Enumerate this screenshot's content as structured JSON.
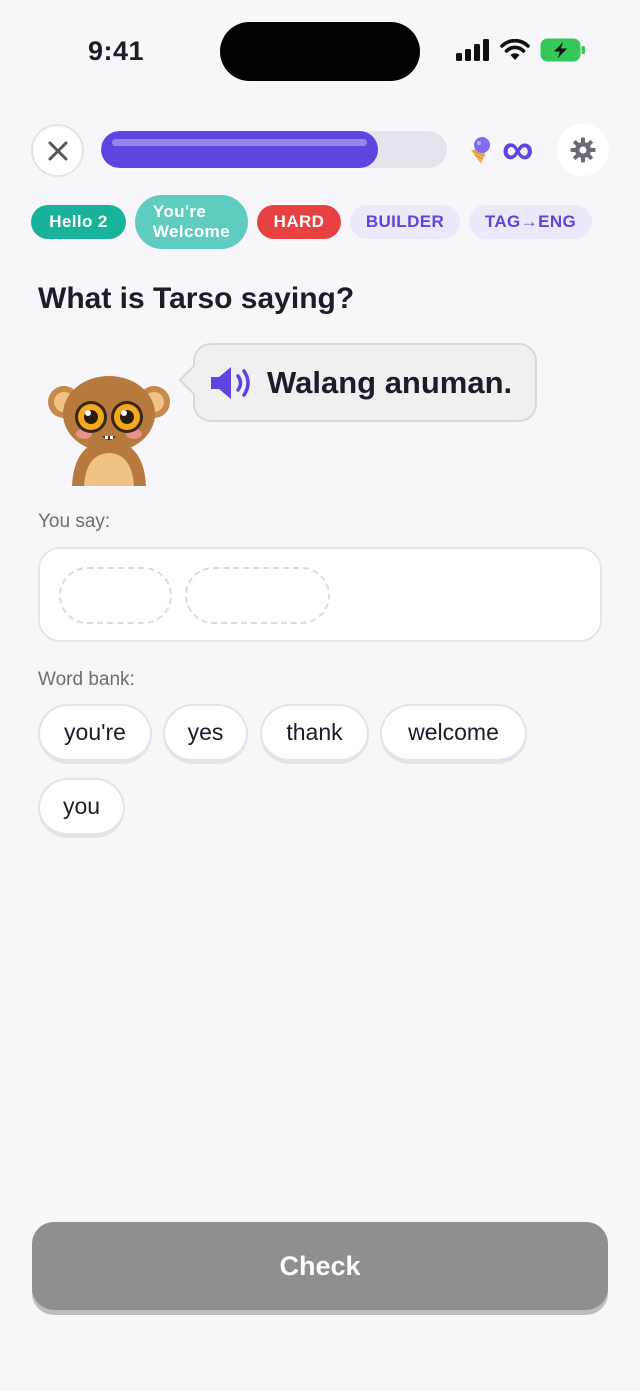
{
  "status_bar": {
    "time": "9:41"
  },
  "progress": {
    "fraction": 0.8
  },
  "hearts": {
    "value": "∞"
  },
  "tags": {
    "lesson": "Hello 2",
    "topic_line1": "You're",
    "topic_line2": "Welcome",
    "difficulty": "HARD",
    "mode": "BUILDER",
    "direction": "TAG→ENG"
  },
  "question": "What is Tarso saying?",
  "bubble": {
    "text": "Walang anuman."
  },
  "answer": {
    "label": "You say:",
    "slots": 2
  },
  "word_bank": {
    "label": "Word bank:",
    "words": [
      "you're",
      "yes",
      "thank",
      "welcome",
      "you"
    ]
  },
  "check_button": {
    "label": "Check"
  },
  "colors": {
    "accent": "#5b46e0",
    "teal": "#18b39a",
    "teal_light": "#5ecdc0",
    "danger": "#e84141",
    "check_disabled": "#8e8e93"
  },
  "icons": [
    "close-icon",
    "ice-cream-icon",
    "infinity-icon",
    "gear-icon",
    "speaker-icon",
    "signal-icon",
    "wifi-icon",
    "battery-icon"
  ]
}
